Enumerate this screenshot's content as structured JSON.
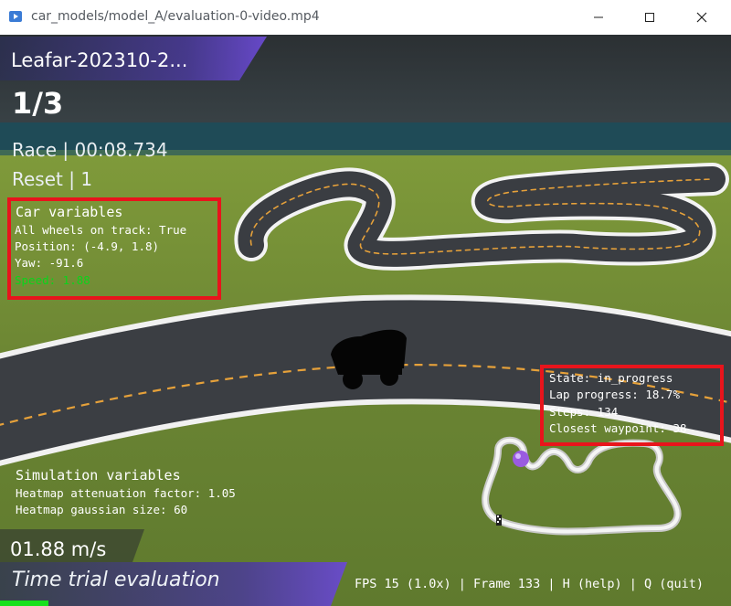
{
  "window": {
    "title": "car_models/model_A/evaluation-0-video.mp4"
  },
  "hud": {
    "racer_name": "Leafar-202310-2...",
    "lap": "1/3",
    "race_time": "Race | 00:08.734",
    "reset": "Reset | 1",
    "car_variables": {
      "title": "Car variables",
      "wheels_on_track": "All wheels on track: True",
      "position": "Position: (-4.9, 1.8)",
      "yaw": "Yaw: -91.6",
      "speed": "Speed: 1.88"
    },
    "state_panel": {
      "state": "State: in_progress",
      "lap_progress": "Lap progress: 18.7%",
      "steps": "Steps: 134",
      "closest_waypoint": "Closest waypoint: 38"
    },
    "simulation_variables": {
      "title": "Simulation variables",
      "attenuation": "Heatmap attenuation factor: 1.05",
      "gaussian": "Heatmap gaussian size: 60"
    },
    "speed_readout": "01.88 m/s",
    "mode": "Time trial evaluation",
    "footer": "FPS 15 (1.0x) | Frame 133 | H (help) | Q (quit)",
    "lap_progress_percent": 18.7
  },
  "colors": {
    "highlight_box": "#e8141c",
    "speed_text": "#0bd41b",
    "banner_purple": "#5a3fb0",
    "progress_green": "#19e01c",
    "grass": "#6f8a36",
    "track": "#3a3d42"
  },
  "icons": {
    "app": "video-player-icon",
    "minimize": "minimize-icon",
    "maximize": "maximize-icon",
    "close": "close-icon"
  }
}
